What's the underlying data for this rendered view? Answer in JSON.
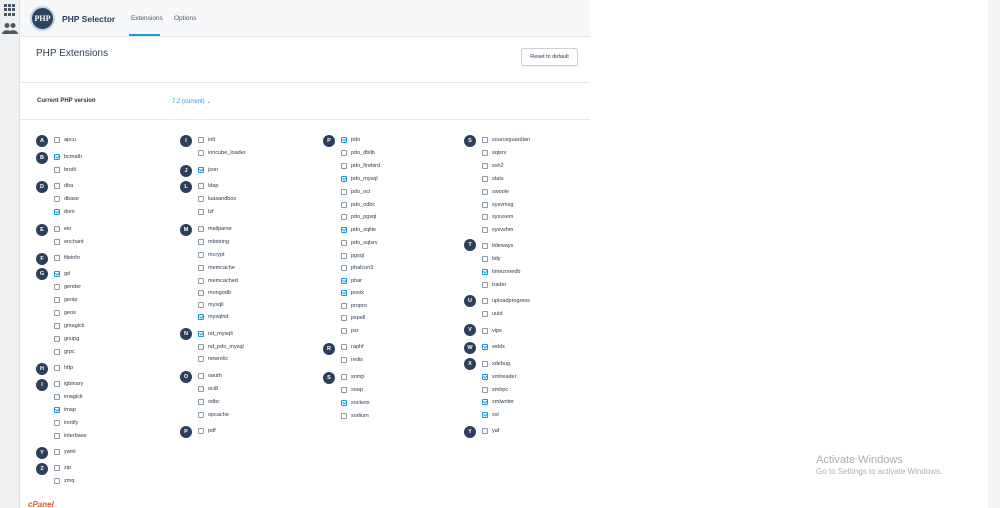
{
  "app": {
    "logo_text": "PHP",
    "title": "PHP Selector",
    "tabs": [
      {
        "label": "Extensions",
        "active": true
      },
      {
        "label": "Options",
        "active": false
      }
    ]
  },
  "page": {
    "title": "PHP Extensions",
    "reset_label": "Reset to default",
    "version_label": "Current PHP version",
    "version_value": "7.2 (current)"
  },
  "colors": {
    "accent": "#179bd7",
    "badge": "#2b3f5a",
    "brand": "#e05a1e"
  },
  "letters": [
    "A",
    "B",
    "D",
    "E",
    "F",
    "G",
    "H",
    "I",
    "Y",
    "Z",
    "I",
    "J",
    "L",
    "M",
    "N",
    "O",
    "P",
    "P",
    "R",
    "S",
    "S",
    "T",
    "U",
    "V",
    "W",
    "X",
    "Y"
  ],
  "extensions": [
    {
      "name": "apcu",
      "checked": false
    },
    {
      "name": "bcmath",
      "checked": true
    },
    {
      "name": "brotli",
      "checked": false
    },
    {
      "name": "dba",
      "checked": false
    },
    {
      "name": "dbase",
      "checked": false
    },
    {
      "name": "dom",
      "checked": true
    },
    {
      "name": "eio",
      "checked": false
    },
    {
      "name": "enchant",
      "checked": false
    },
    {
      "name": "fileinfo",
      "checked": false
    },
    {
      "name": "gd",
      "checked": true
    },
    {
      "name": "gender",
      "checked": false
    },
    {
      "name": "geoip",
      "checked": false
    },
    {
      "name": "geos",
      "checked": false
    },
    {
      "name": "gmagick",
      "checked": false
    },
    {
      "name": "gnupg",
      "checked": false
    },
    {
      "name": "grpc",
      "checked": false
    },
    {
      "name": "http",
      "checked": false
    },
    {
      "name": "igbinary",
      "checked": false
    },
    {
      "name": "imagick",
      "checked": false
    },
    {
      "name": "imap",
      "checked": true
    },
    {
      "name": "inotify",
      "checked": false
    },
    {
      "name": "interbase",
      "checked": false
    },
    {
      "name": "yaml",
      "checked": false
    },
    {
      "name": "zip",
      "checked": false
    },
    {
      "name": "zmq",
      "checked": false
    },
    {
      "name": "intl",
      "checked": false
    },
    {
      "name": "ioncube_loader",
      "checked": false
    },
    {
      "name": "json",
      "checked": true
    },
    {
      "name": "ldap",
      "checked": false
    },
    {
      "name": "luasandbox",
      "checked": false
    },
    {
      "name": "lzf",
      "checked": false
    },
    {
      "name": "mailparse",
      "checked": false
    },
    {
      "name": "mbstring",
      "checked": false
    },
    {
      "name": "mcrypt",
      "checked": false
    },
    {
      "name": "memcache",
      "checked": false
    },
    {
      "name": "memcached",
      "checked": false
    },
    {
      "name": "mongodb",
      "checked": false
    },
    {
      "name": "mysqli",
      "checked": false
    },
    {
      "name": "mysqlnd",
      "checked": true
    },
    {
      "name": "nd_mysqli",
      "checked": true
    },
    {
      "name": "nd_pdo_mysql",
      "checked": false
    },
    {
      "name": "newrelic",
      "checked": false
    },
    {
      "name": "oauth",
      "checked": false
    },
    {
      "name": "oci8",
      "checked": false
    },
    {
      "name": "odbc",
      "checked": false
    },
    {
      "name": "opcache",
      "checked": false
    },
    {
      "name": "pdf",
      "checked": false
    },
    {
      "name": "pdo",
      "checked": true
    },
    {
      "name": "pdo_dblib",
      "checked": false
    },
    {
      "name": "pdo_firebird",
      "checked": false
    },
    {
      "name": "pdo_mysql",
      "checked": true
    },
    {
      "name": "pdo_oci",
      "checked": false
    },
    {
      "name": "pdo_odbc",
      "checked": false
    },
    {
      "name": "pdo_pgsql",
      "checked": false
    },
    {
      "name": "pdo_sqlite",
      "checked": true
    },
    {
      "name": "pdo_sqlsrv",
      "checked": false
    },
    {
      "name": "pgsql",
      "checked": false
    },
    {
      "name": "phalcon3",
      "checked": false
    },
    {
      "name": "phar",
      "checked": true
    },
    {
      "name": "posix",
      "checked": true
    },
    {
      "name": "propro",
      "checked": false
    },
    {
      "name": "pspell",
      "checked": false
    },
    {
      "name": "psr",
      "checked": false
    },
    {
      "name": "raphf",
      "checked": false
    },
    {
      "name": "redis",
      "checked": false
    },
    {
      "name": "snmp",
      "checked": false
    },
    {
      "name": "soap",
      "checked": false
    },
    {
      "name": "sockets",
      "checked": true
    },
    {
      "name": "sodium",
      "checked": false
    },
    {
      "name": "sourceguardian",
      "checked": false
    },
    {
      "name": "sqlsrv",
      "checked": false
    },
    {
      "name": "ssh2",
      "checked": false
    },
    {
      "name": "stats",
      "checked": false
    },
    {
      "name": "swoole",
      "checked": false
    },
    {
      "name": "sysvmsg",
      "checked": false
    },
    {
      "name": "sysvsem",
      "checked": false
    },
    {
      "name": "sysvshm",
      "checked": false
    },
    {
      "name": "tideways",
      "checked": false
    },
    {
      "name": "tidy",
      "checked": false
    },
    {
      "name": "timezonedb",
      "checked": true
    },
    {
      "name": "trader",
      "checked": false
    },
    {
      "name": "uploadprogress",
      "checked": false
    },
    {
      "name": "uuid",
      "checked": false
    },
    {
      "name": "vips",
      "checked": false
    },
    {
      "name": "wddx",
      "checked": true
    },
    {
      "name": "xdebug",
      "checked": false
    },
    {
      "name": "xmlreader",
      "checked": true
    },
    {
      "name": "xmlrpc",
      "checked": false
    },
    {
      "name": "xmlwriter",
      "checked": true
    },
    {
      "name": "xsl",
      "checked": true
    },
    {
      "name": "yaf",
      "checked": false
    }
  ],
  "watermark": {
    "title": "Activate Windows",
    "subtitle": "Go to Settings to activate Windows."
  },
  "footer": {
    "logo": "cPanel"
  }
}
